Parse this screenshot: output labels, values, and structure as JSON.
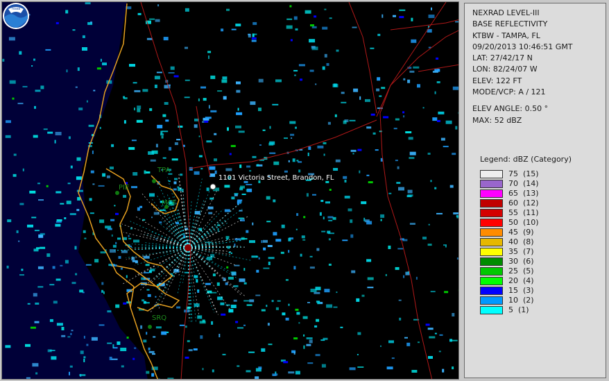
{
  "info": {
    "lines": [
      "NEXRAD LEVEL-III",
      "BASE REFLECTIVITY",
      "KTBW - TAMPA, FL",
      "09/20/2013 10:46:51 GMT",
      "LAT: 27/42/17 N",
      "LON: 82/24/07 W",
      "ELEV: 122 FT",
      "MODE/VCP: A / 121"
    ],
    "elev_angle": "ELEV ANGLE: 0.50 °",
    "max": "MAX: 52 dBZ"
  },
  "legend": {
    "title": "Legend: dBZ (Category)",
    "items": [
      {
        "label": "75  (15)",
        "color": "#eeeeee"
      },
      {
        "label": "70  (14)",
        "color": "#9966cc"
      },
      {
        "label": "65  (13)",
        "color": "#ff00ff"
      },
      {
        "label": "60  (12)",
        "color": "#c00000"
      },
      {
        "label": "55  (11)",
        "color": "#d40000"
      },
      {
        "label": "50  (10)",
        "color": "#ff0000"
      },
      {
        "label": "45  (9)",
        "color": "#ff8c00"
      },
      {
        "label": "40  (8)",
        "color": "#e6b800"
      },
      {
        "label": "35  (7)",
        "color": "#ffff00"
      },
      {
        "label": "30  (6)",
        "color": "#008c00"
      },
      {
        "label": "25  (5)",
        "color": "#00c800"
      },
      {
        "label": "20  (4)",
        "color": "#00ff00"
      },
      {
        "label": "15  (3)",
        "color": "#0000ff"
      },
      {
        "label": "10  (2)",
        "color": "#0099ff"
      },
      {
        "label": "5  (1)",
        "color": "#00ffff"
      }
    ]
  },
  "map": {
    "address": "1101 Victoria Street, Brandon, FL",
    "places": [
      "TPA",
      "PIE",
      "MCF",
      "SRQ"
    ]
  },
  "colors": {
    "coast": "#e6a020",
    "roads": "#b01818",
    "echo": "#00d7e6",
    "echo2": "#1e90ff",
    "water": "#000040"
  },
  "icons": [
    "noaa-logo-icon",
    "location-marker-icon"
  ]
}
